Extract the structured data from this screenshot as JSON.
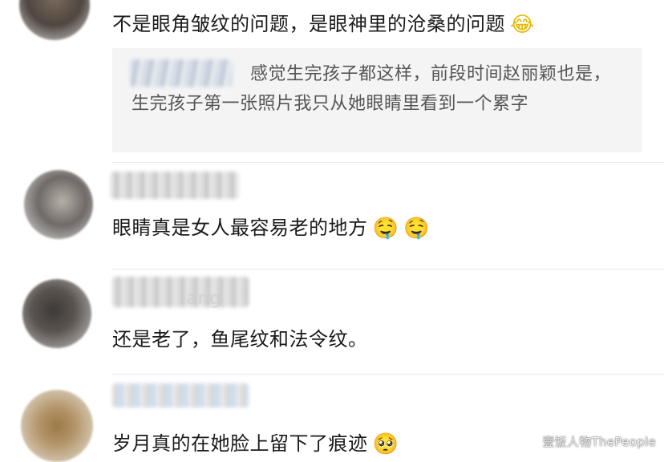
{
  "comments": [
    {
      "text": "不是眼角皱纹的问题，是眼神里的沧桑的问题",
      "emojis": [
        "😂"
      ],
      "name_partial": ""
    },
    {
      "text": "眼睛真是女人最容易老的地方",
      "emojis": [
        "🤤",
        "🤤"
      ],
      "name_partial": ""
    },
    {
      "text": "还是老了，鱼尾纹和法令纹。",
      "emojis": [],
      "name_partial": "ang"
    },
    {
      "text": "岁月真的在她脸上留下了痕迹",
      "emojis": [
        "🥺"
      ],
      "name_partial": ""
    }
  ],
  "quote": {
    "text": "感觉生完孩子都这样，前段时间赵丽颖也是，生完孩子第一张照片我只从她眼睛里看到一个累字"
  },
  "watermark": "壹饭人物ThePeople",
  "colors": {
    "background": "#ffffff",
    "quote_background": "#f4f4f5",
    "divider": "#e9e9e9",
    "text": "#1a1a1a",
    "quote_text": "#555555"
  },
  "icons": [
    "laughing-tears-emoji",
    "shy-sweat-emoji",
    "pleading-face-emoji"
  ]
}
